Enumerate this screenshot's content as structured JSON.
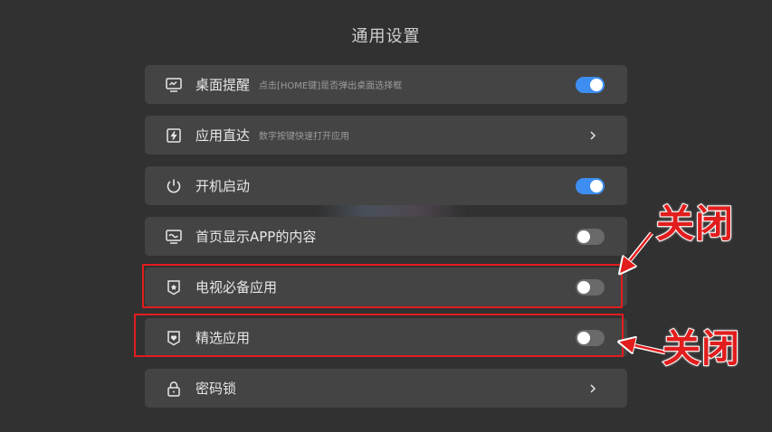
{
  "page": {
    "title": "通用设置"
  },
  "settings": [
    {
      "label": "桌面提醒",
      "sub": "点击[HOME键]是否弹出桌面选择框",
      "control": "toggle",
      "on": true,
      "icon": "monitor-icon"
    },
    {
      "label": "应用直达",
      "sub": "数字按键快速打开应用",
      "control": "chevron",
      "icon": "lightning-icon"
    },
    {
      "label": "开机启动",
      "sub": "",
      "control": "toggle",
      "on": true,
      "icon": "power-icon"
    },
    {
      "label": "首页显示APP的内容",
      "sub": "",
      "control": "toggle",
      "on": false,
      "icon": "display-wave-icon"
    },
    {
      "label": "电视必备应用",
      "sub": "",
      "control": "toggle",
      "on": false,
      "icon": "star-shield-icon"
    },
    {
      "label": "精选应用",
      "sub": "",
      "control": "toggle",
      "on": false,
      "icon": "heart-shield-icon"
    },
    {
      "label": "密码锁",
      "sub": "",
      "control": "chevron",
      "icon": "lock-icon"
    }
  ],
  "annotations": {
    "close_label_1": "关闭",
    "close_label_2": "关闭"
  },
  "colors": {
    "background": "#313131",
    "row": "#444444",
    "toggle_on": "#3d8ef0",
    "toggle_off": "#6a6a6a",
    "annotation_red": "#e21d1d"
  }
}
